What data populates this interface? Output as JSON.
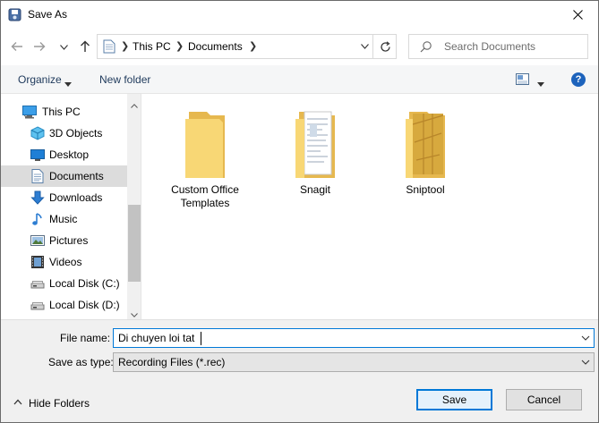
{
  "window": {
    "title": "Save As"
  },
  "address": {
    "crumbs": [
      "This PC",
      "Documents"
    ]
  },
  "search": {
    "placeholder": "Search Documents"
  },
  "toolbar": {
    "organize": "Organize",
    "new_folder": "New folder",
    "help": "?"
  },
  "nav": {
    "items": [
      {
        "label": "This PC",
        "icon": "pc-icon"
      },
      {
        "label": "3D Objects",
        "icon": "3d-objects-icon"
      },
      {
        "label": "Desktop",
        "icon": "desktop-icon"
      },
      {
        "label": "Documents",
        "icon": "documents-icon",
        "selected": true
      },
      {
        "label": "Downloads",
        "icon": "downloads-icon"
      },
      {
        "label": "Music",
        "icon": "music-icon"
      },
      {
        "label": "Pictures",
        "icon": "pictures-icon"
      },
      {
        "label": "Videos",
        "icon": "videos-icon"
      },
      {
        "label": "Local Disk (C:)",
        "icon": "drive-icon"
      },
      {
        "label": "Local Disk (D:)",
        "icon": "drive-icon"
      }
    ]
  },
  "folders": [
    {
      "label": "Custom Office Templates"
    },
    {
      "label": "Snagit"
    },
    {
      "label": "Sniptool"
    }
  ],
  "form": {
    "file_name_label": "File name:",
    "file_name_value": "Di chuyen loi tat",
    "save_type_label": "Save as type:",
    "save_type_value": "Recording Files (*.rec)",
    "hide_folders": "Hide Folders",
    "save": "Save",
    "cancel": "Cancel"
  },
  "colors": {
    "accent": "#0078d7",
    "folder": "#f8d775",
    "selected_nav": "#dcdcdc"
  }
}
